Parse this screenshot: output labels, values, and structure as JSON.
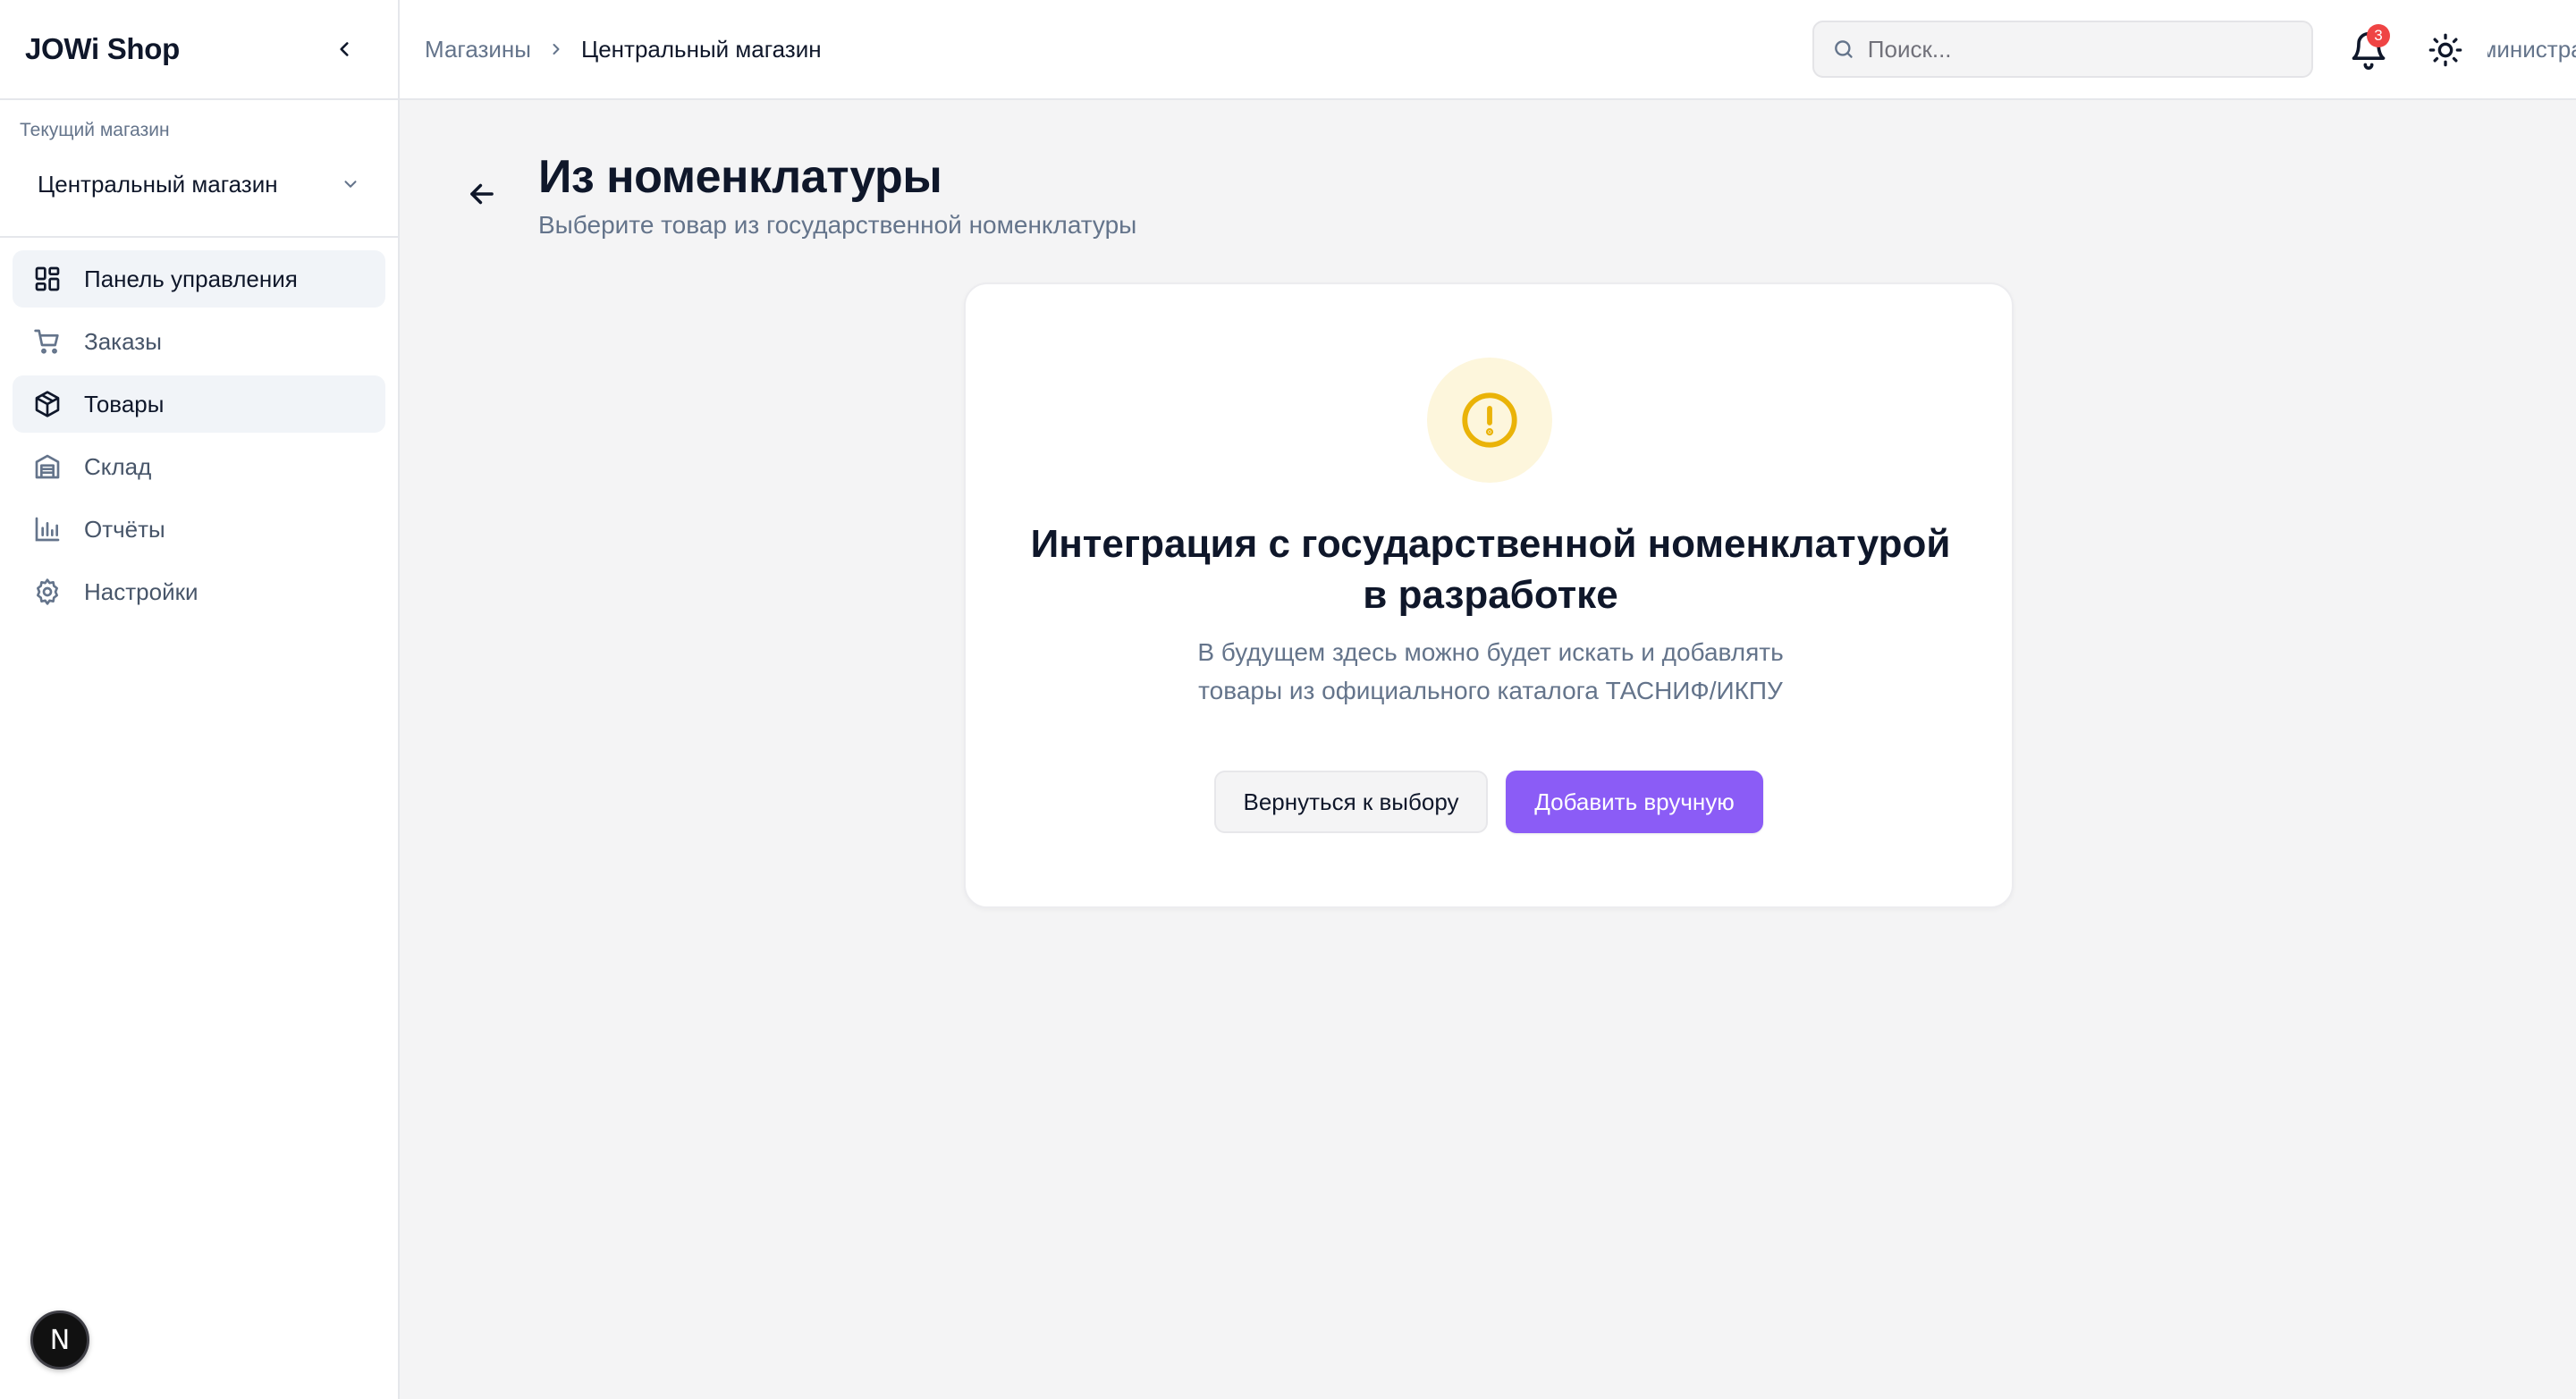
{
  "sidebar": {
    "brand": "JOWi Shop",
    "store_caption": "Текущий магазин",
    "store_selected": "Центральный магазин",
    "items": [
      {
        "label": "Панель управления",
        "icon": "dashboard-icon",
        "active": true
      },
      {
        "label": "Заказы",
        "icon": "cart-icon",
        "active": false
      },
      {
        "label": "Товары",
        "icon": "box-icon",
        "active": true
      },
      {
        "label": "Склад",
        "icon": "warehouse-icon",
        "active": false
      },
      {
        "label": "Отчёты",
        "icon": "bar-chart-icon",
        "active": false
      },
      {
        "label": "Настройки",
        "icon": "gear-icon",
        "active": false
      }
    ],
    "dev_badge": "N"
  },
  "topbar": {
    "breadcrumb": {
      "parent": "Магазины",
      "current": "Центральный магазин"
    },
    "search_placeholder": "Поиск...",
    "notification_count": "3",
    "user_name": "Администратор"
  },
  "page": {
    "title": "Из номенклатуры",
    "subtitle": "Выберите товар из государственной номенклатуры"
  },
  "notice": {
    "icon": "alert-circle-icon",
    "title_line1": "Интеграция с государственной номенклатурой",
    "title_line2": "в разработке",
    "text_line1": "В будущем здесь можно будет искать и добавлять",
    "text_line2": "товары из официального каталога ТАСНИФ/ИКПУ",
    "back_button": "Вернуться к выбору",
    "manual_button": "Добавить вручную"
  },
  "colors": {
    "accent": "#8b5cf6",
    "warning": "#eab308",
    "badge": "#ef4444"
  }
}
